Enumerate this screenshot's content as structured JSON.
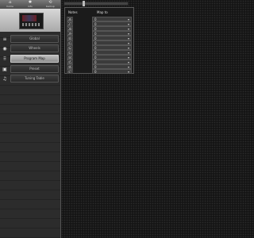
{
  "toolbar": {
    "items": [
      {
        "icon": "home-icon",
        "glyph": "⌂",
        "label": "home"
      },
      {
        "icon": "gear-icon",
        "glyph": "✱",
        "label": "info"
      },
      {
        "icon": "backup-icon",
        "glyph": "⟲",
        "label": "backup"
      }
    ]
  },
  "sidebar": {
    "items": [
      {
        "icon": "global-icon",
        "glyph": "≡",
        "label": "Global"
      },
      {
        "icon": "wheel-icon",
        "glyph": "◉",
        "label": "Wheels"
      },
      {
        "icon": "program-map-icon",
        "glyph": "⠿",
        "label": "Program Map"
      },
      {
        "icon": "preset-icon",
        "glyph": "▣",
        "label": "Preset"
      },
      {
        "icon": "tuning-table-icon",
        "glyph": "♫",
        "label": "Tuning Table"
      }
    ],
    "active_index": 2
  },
  "slider": {
    "value_fraction": 0.3
  },
  "program_map": {
    "headers": [
      "Notes",
      "Map to"
    ],
    "rows": [
      {
        "note": "36",
        "value": "0"
      },
      {
        "note": "37",
        "value": "0"
      },
      {
        "note": "38",
        "value": "0"
      },
      {
        "note": "39",
        "value": "0"
      },
      {
        "note": "40",
        "value": "0"
      },
      {
        "note": "41",
        "value": "0"
      },
      {
        "note": "42",
        "value": "0"
      },
      {
        "note": "43",
        "value": "0"
      },
      {
        "note": "44",
        "value": "0"
      },
      {
        "note": "45",
        "value": "0"
      },
      {
        "note": "46",
        "value": "0"
      },
      {
        "note": "47",
        "value": "0"
      }
    ]
  }
}
